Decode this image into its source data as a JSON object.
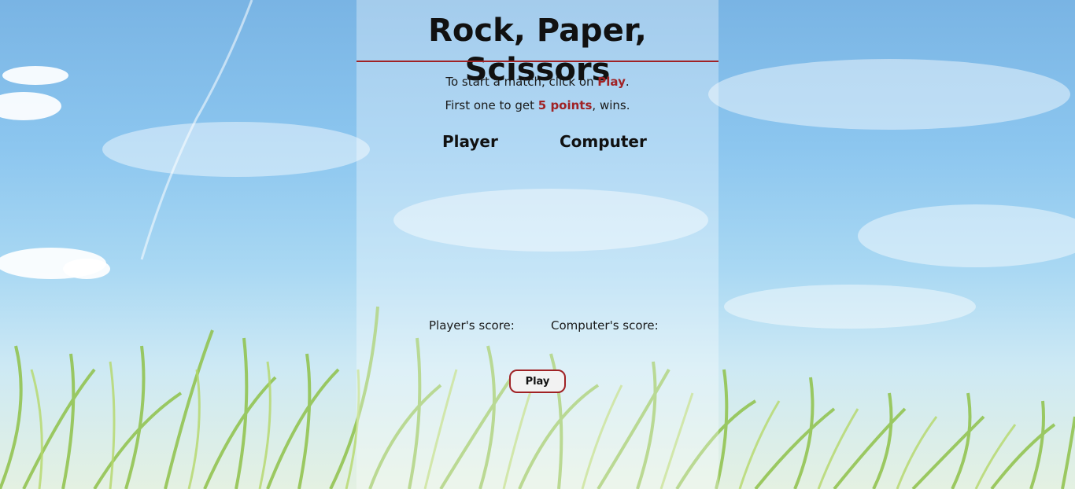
{
  "page": {
    "title": "Rock, Paper, Scissors"
  },
  "intro": {
    "line1_before": "To start a match, click on ",
    "line1_highlight": "Play",
    "line1_after": ".",
    "line2_before": "First one to get ",
    "line2_highlight": "5 points",
    "line2_after": ", wins."
  },
  "columns": {
    "player": "Player",
    "computer": "Computer"
  },
  "scores": {
    "player_label": "Player's score:",
    "computer_label": "Computer's score:"
  },
  "controls": {
    "play_label": "Play"
  },
  "colors": {
    "accent": "#a02225",
    "panel_overlay": "rgba(255,255,255,0.32)"
  }
}
